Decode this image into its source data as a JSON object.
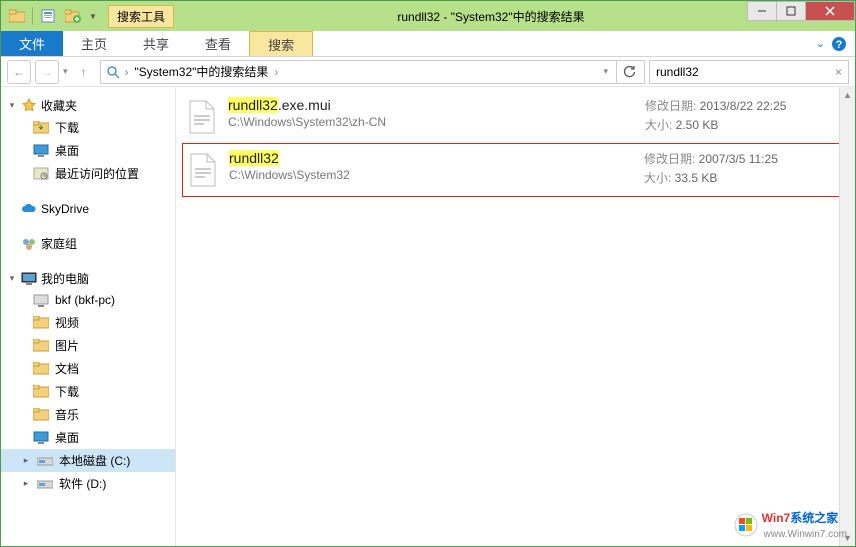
{
  "titlebar": {
    "search_tool_label": "搜索工具",
    "title": "rundll32 - \"System32\"中的搜索结果"
  },
  "ribbon": {
    "file": "文件",
    "home": "主页",
    "share": "共享",
    "view": "查看",
    "search": "搜索"
  },
  "addrbar": {
    "crumb": "\"System32\"中的搜索结果",
    "search_value": "rundll32"
  },
  "sidebar": {
    "favorites": {
      "label": "收藏夹",
      "items": [
        "下载",
        "桌面",
        "最近访问的位置"
      ]
    },
    "skydrive": "SkyDrive",
    "homegroup": "家庭组",
    "mypc": {
      "label": "我的电脑",
      "items": [
        "bkf (bkf-pc)",
        "视频",
        "图片",
        "文档",
        "下载",
        "音乐",
        "桌面",
        "本地磁盘 (C:)",
        "软件 (D:)"
      ]
    }
  },
  "results": [
    {
      "name_hl": "rundll32",
      "name_rest": ".exe.mui",
      "path": "C:\\Windows\\System32\\zh-CN",
      "date_label": "修改日期:",
      "date": "2013/8/22 22:25",
      "size_label": "大小:",
      "size": "2.50 KB",
      "highlighted": false
    },
    {
      "name_hl": "rundll32",
      "name_rest": "",
      "path": "C:\\Windows\\System32",
      "date_label": "修改日期:",
      "date": "2007/3/5 11:25",
      "size_label": "大小:",
      "size": "33.5 KB",
      "highlighted": true
    }
  ],
  "watermark": {
    "brand1": "Win7",
    "brand2": "系统之家",
    "url": "www.Winwin7.com"
  }
}
